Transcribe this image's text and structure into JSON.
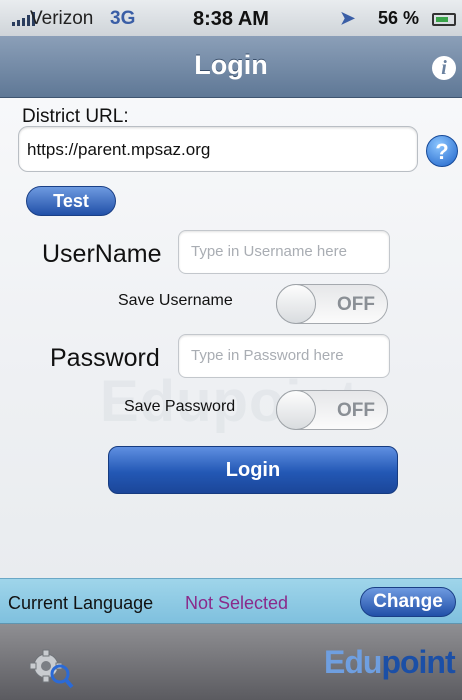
{
  "status_bar": {
    "carrier": "Verizon",
    "network": "3G",
    "time": "8:38 AM",
    "battery": "56 %",
    "icons": [
      "signal-icon",
      "location-icon",
      "alarm-icon",
      "battery-icon"
    ]
  },
  "nav": {
    "title": "Login",
    "info_icon": "i"
  },
  "district": {
    "label": "District URL:",
    "value": "https://parent.mpsaz.org"
  },
  "help_icon": "?",
  "test_button": "Test",
  "username": {
    "label": "UserName",
    "placeholder": "Type in Username here"
  },
  "save_username": {
    "label": "Save Username",
    "state": "OFF"
  },
  "password": {
    "label": "Password",
    "placeholder": "Type in Password here"
  },
  "save_password": {
    "label": "Save Password",
    "state": "OFF"
  },
  "login_button": "Login",
  "language": {
    "label": "Current Language",
    "value": "Not Selected",
    "change_button": "Change"
  },
  "brand": {
    "part1": "Edu",
    "part2": "point"
  },
  "colors": {
    "accent": "#2358b5",
    "nav": "#6f86a5",
    "language_bar": "#8fcbe4",
    "language_value": "#8a2a8a"
  }
}
